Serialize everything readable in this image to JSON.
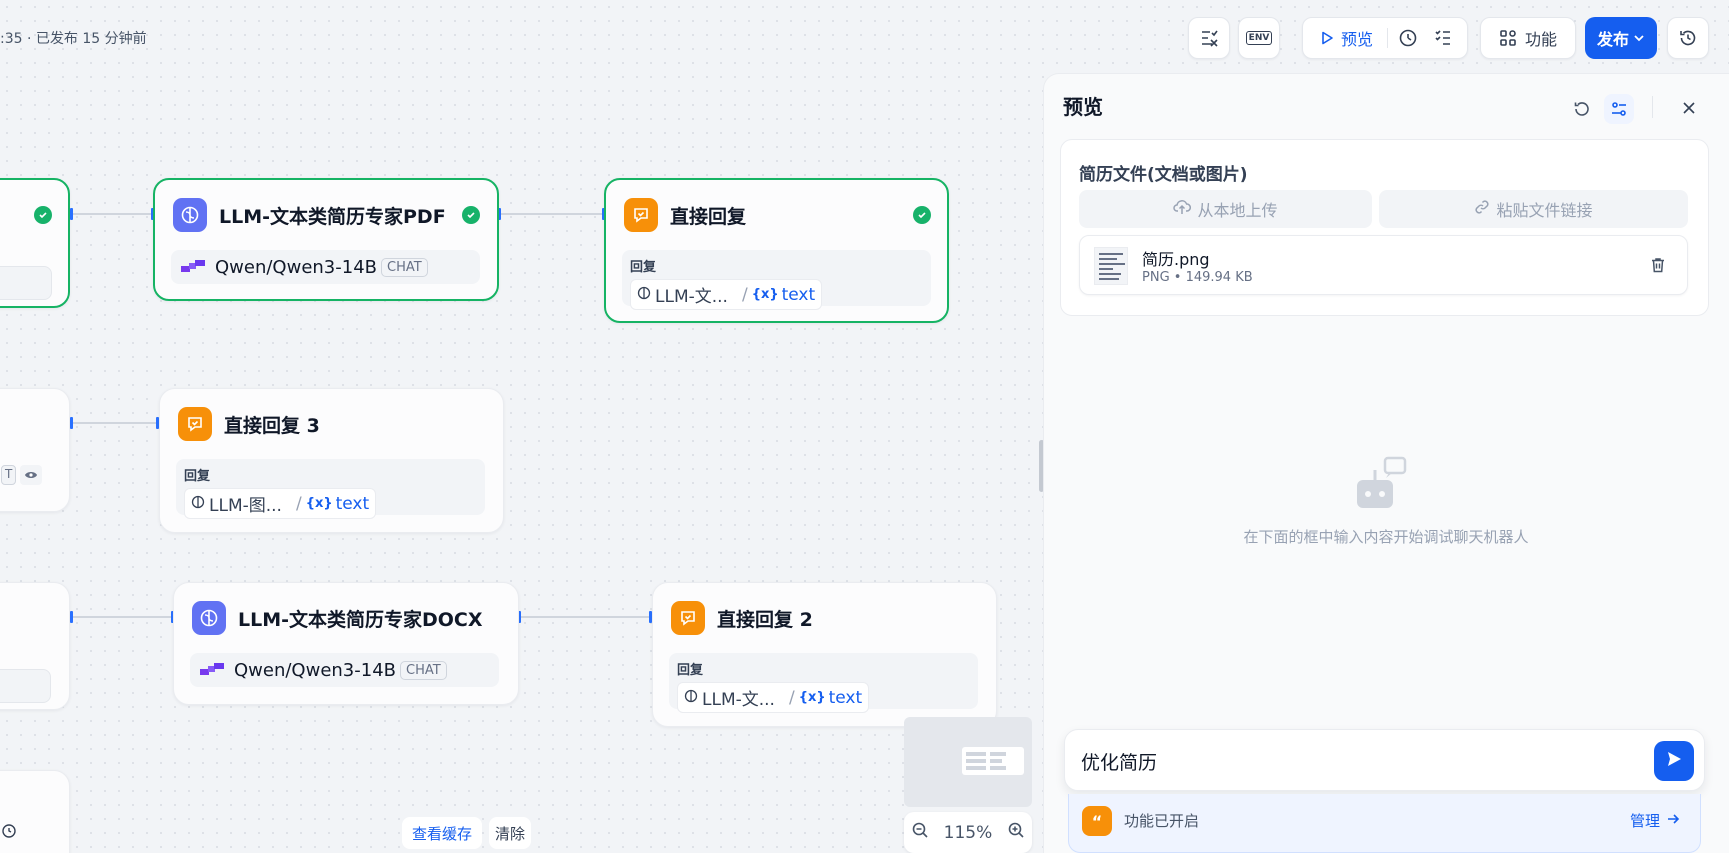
{
  "topbar": {
    "status": ":35 · 已发布 15 分钟前",
    "env_label": "ENV",
    "preview_label": "预览",
    "features_label": "功能",
    "publish_label": "发布"
  },
  "nodes": {
    "llm_pdf": {
      "title": "LLM-文本类简历专家PDF",
      "model": "Qwen/Qwen3-14B",
      "mode": "CHAT"
    },
    "answer_1": {
      "title": "直接回复",
      "reply_label": "回复",
      "source": "LLM-文...",
      "var": "text"
    },
    "answer_3": {
      "title": "直接回复 3",
      "reply_label": "回复",
      "source": "LLM-图...",
      "var": "text"
    },
    "llm_docx": {
      "title": "LLM-文本类简历专家DOCX",
      "model": "Qwen/Qwen3-14B",
      "mode": "CHAT"
    },
    "answer_2": {
      "title": "直接回复 2",
      "reply_label": "回复",
      "source": "LLM-文...",
      "var": "text"
    }
  },
  "partial_node": {
    "badge": "T"
  },
  "bottom": {
    "view_cache": "查看缓存",
    "clear": "清除",
    "zoom": "115%"
  },
  "preview": {
    "title": "预览",
    "field_label": "简历文件(文档或图片)",
    "upload_local": "从本地上传",
    "paste_link": "粘贴文件链接",
    "file": {
      "name": "简历.png",
      "type": "PNG",
      "size": "149.94 KB"
    },
    "empty_hint": "在下面的框中输入内容开始调试聊天机器人",
    "input_value": "优化简历",
    "feature_status": "功能已开启",
    "manage_label": "管理"
  },
  "colors": {
    "accent": "#155eef",
    "success": "#17b26a",
    "llm_icon": "#6172f3",
    "answer_icon": "#f79009"
  }
}
